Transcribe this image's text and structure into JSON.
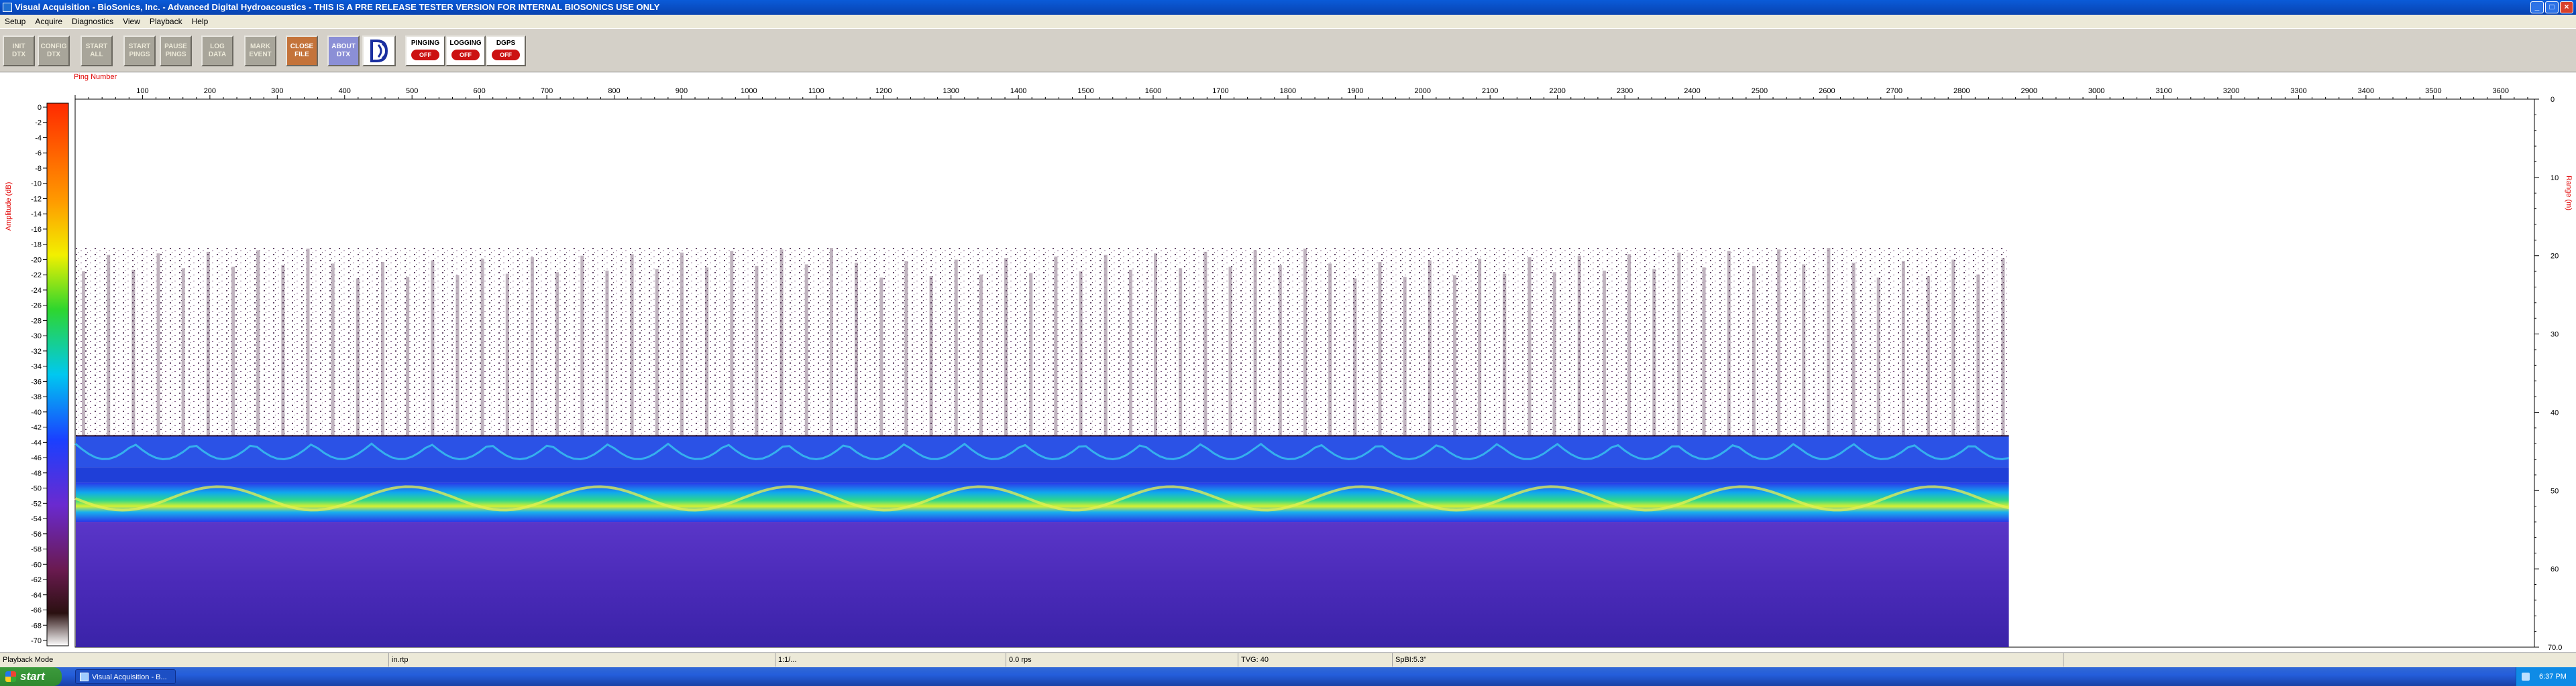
{
  "window": {
    "title": "Visual Acquisition  -  BioSonics, Inc.  -  Advanced Digital Hydroacoustics  -  THIS IS A PRE RELEASE TESTER VERSION FOR INTERNAL BIOSONICS USE ONLY",
    "buttons": [
      "_",
      "□",
      "×"
    ]
  },
  "menu": [
    "Setup",
    "Acquire",
    "Diagnostics",
    "View",
    "Playback",
    "Help"
  ],
  "toolbar": {
    "buttons": [
      {
        "label": "INIT\nDTX"
      },
      {
        "label": "CONFIG\nDTX"
      },
      {
        "label": "START\nALL"
      },
      {
        "label": "START\nPINGS"
      },
      {
        "label": "PAUSE\nPINGS"
      },
      {
        "label": "LOG\nDATA"
      },
      {
        "label": "MARK\nEVENT"
      },
      {
        "label": "CLOSE\nFILE"
      },
      {
        "label": "ABOUT\nDTX"
      }
    ],
    "status": [
      {
        "label": "PINGING",
        "state": "OFF"
      },
      {
        "label": "LOGGING",
        "state": "OFF"
      },
      {
        "label": "DGPS",
        "state": "OFF"
      }
    ]
  },
  "plot": {
    "x_axis_title": "Ping Number",
    "left_axis_title": "Amplitude (dB)",
    "right_axis_title": "Range (m)",
    "colors": {
      "axis_title": "#e00000"
    }
  },
  "chart_data": {
    "type": "heatmap",
    "x_axis": {
      "label": "Ping Number",
      "min": 0,
      "max": 3650,
      "ticks": [
        100,
        200,
        300,
        400,
        500,
        600,
        700,
        800,
        900,
        1000,
        1100,
        1200,
        1300,
        1400,
        1500,
        1600,
        1700,
        1800,
        1900,
        2000,
        2100,
        2200,
        2300,
        2400,
        2500,
        2600,
        2700,
        2800,
        2900,
        3000,
        3100,
        3200,
        3300,
        3400,
        3500,
        3600
      ]
    },
    "y_axis_right": {
      "label": "Range (m)",
      "min": 0,
      "max": 70,
      "ticks": [
        0,
        10,
        20,
        30,
        40,
        50,
        60
      ],
      "end_label": "70.0"
    },
    "colorbar": {
      "label": "Amplitude (dB)",
      "min": -70,
      "max": 0,
      "ticks": [
        0,
        -2,
        -4,
        -6,
        -8,
        -10,
        -12,
        -14,
        -16,
        -18,
        -20,
        -22,
        -24,
        -26,
        -28,
        -30,
        -32,
        -34,
        -36,
        -38,
        -40,
        -42,
        -44,
        -46,
        -48,
        -50,
        -52,
        -54,
        -56,
        -58,
        -60,
        -62,
        -64,
        -66,
        -68,
        -70
      ]
    },
    "data_extent_pings": 2870,
    "echo_bands_range_m": [
      {
        "name": "",
        "start": 43,
        "end": 47
      },
      {
        "name": "",
        "start": 49,
        "end": 54
      },
      {
        "name": "",
        "start": 54,
        "end": 70
      }
    ],
    "noise_region_range_m": [
      19,
      43
    ]
  },
  "statusbar": {
    "panels": [
      "Playback Mode",
      "in.rtp",
      "1:1/...",
      "0.0 rps",
      "TVG: 40",
      "SpBI:5.3\""
    ]
  },
  "taskbar": {
    "start_label": "start",
    "task_label": "Visual Acquisition - B...",
    "clock": "6:37 PM"
  }
}
